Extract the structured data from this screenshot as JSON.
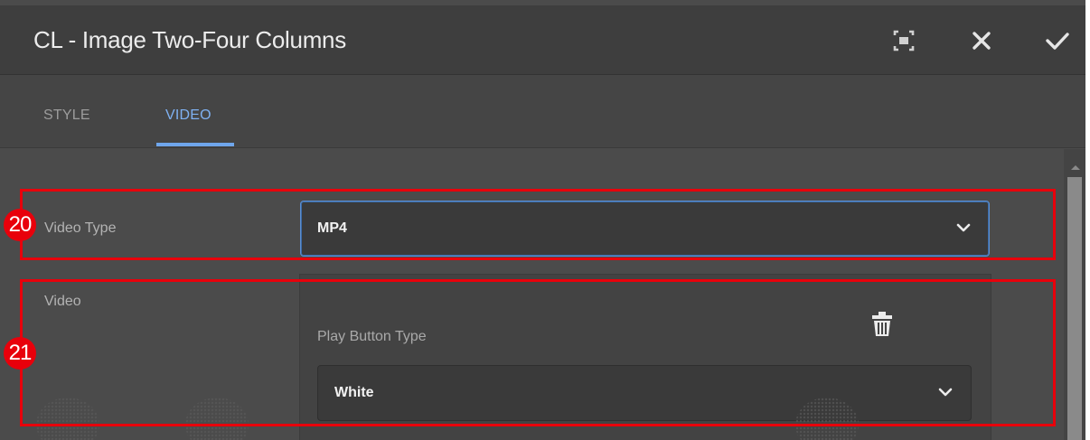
{
  "dialog": {
    "title": "CL - Image Two-Four Columns",
    "icons": [
      "fullscreen-icon",
      "close-icon",
      "checkmark-icon"
    ]
  },
  "tabs": [
    {
      "label": "STYLE",
      "active": false
    },
    {
      "label": "VIDEO",
      "active": true
    }
  ],
  "form": {
    "video_type": {
      "label": "Video Type",
      "value": "MP4"
    },
    "video": {
      "label": "Video",
      "play_button_type": {
        "label": "Play Button Type",
        "value": "White"
      }
    }
  },
  "annotations": [
    {
      "number": "20"
    },
    {
      "number": "21"
    }
  ],
  "colors": {
    "accent": "#6fa6ec",
    "annotation": "#e8000b",
    "background": "#4b4b4b",
    "titlebar": "#3e3e3e"
  }
}
